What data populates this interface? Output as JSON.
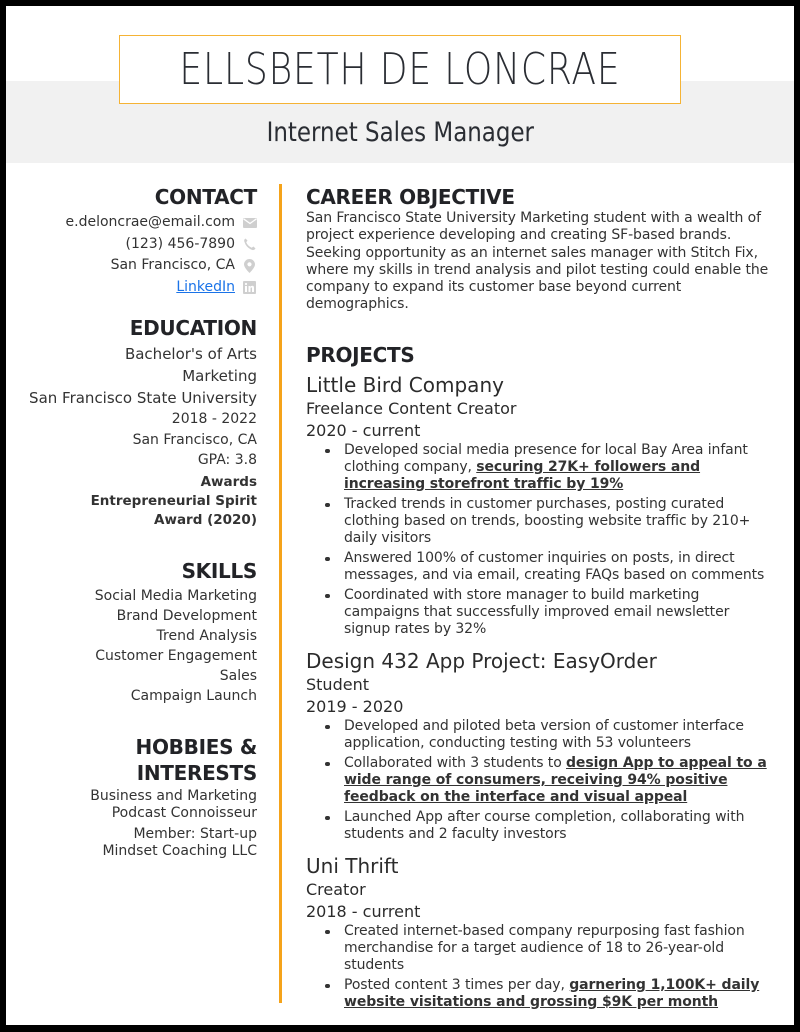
{
  "header": {
    "name": "ELLSBETH DE LONCRAE",
    "title": "Internet Sales Manager",
    "accent_color": "#f5a31a"
  },
  "contact": {
    "heading": "CONTACT",
    "email": "e.deloncrae@email.com",
    "email_icon": "envelope-icon",
    "phone": "(123) 456-7890",
    "phone_icon": "phone-icon",
    "location": "San Francisco, CA",
    "location_icon": "map-pin-icon",
    "linkedin_label": "LinkedIn",
    "linkedin_icon": "linkedin-icon"
  },
  "education": {
    "heading": "EDUCATION",
    "degree": "Bachelor's of Arts",
    "major": "Marketing",
    "school": "San Francisco State University",
    "years": "2018 - 2022",
    "location": "San Francisco, CA",
    "gpa": "GPA: 3.8",
    "awards_label": "Awards",
    "award": "Entrepreneurial Spirit Award (2020)"
  },
  "skills": {
    "heading": "SKILLS",
    "items": [
      "Social Media Marketing",
      "Brand Development",
      "Trend Analysis",
      "Customer Engagement",
      "Sales",
      "Campaign Launch"
    ]
  },
  "hobbies": {
    "heading": "HOBBIES & INTERESTS",
    "items": [
      "Business and Marketing Podcast Connoisseur",
      "Member: Start-up Mindset Coaching LLC"
    ]
  },
  "objective": {
    "heading": "CAREER OBJECTIVE",
    "text": "San Francisco State University Marketing student with a wealth of project experience developing and creating SF-based brands. Seeking opportunity as an internet sales manager with Stitch Fix, where my skills in trend analysis and pilot testing could enable the company to expand its customer base beyond current demographics."
  },
  "projects": {
    "heading": "PROJECTS",
    "items": [
      {
        "name": "Little Bird Company",
        "role": "Freelance Content Creator",
        "dates": "2020 - current",
        "bullets": [
          {
            "pre": "Developed social media presence for local Bay Area infant clothing company, ",
            "hl": "securing 27K+ followers and increasing storefront traffic by 19%",
            "post": ""
          },
          {
            "pre": "Tracked trends in customer purchases, posting curated clothing based on trends, boosting website traffic by 210+ daily visitors",
            "hl": "",
            "post": ""
          },
          {
            "pre": "Answered 100% of customer inquiries on posts, in direct messages, and via email, creating FAQs based on comments",
            "hl": "",
            "post": ""
          },
          {
            "pre": "Coordinated with store manager to build marketing campaigns that successfully improved email newsletter signup rates by 32%",
            "hl": "",
            "post": ""
          }
        ]
      },
      {
        "name": "Design 432 App Project: EasyOrder",
        "role": "Student",
        "dates": "2019 - 2020",
        "bullets": [
          {
            "pre": "Developed and piloted beta version of customer interface application, conducting testing with 53 volunteers",
            "hl": "",
            "post": ""
          },
          {
            "pre": "Collaborated with 3 students to ",
            "hl": "design App to appeal to a wide range of consumers, receiving 94% positive feedback on the interface and visual appeal",
            "post": ""
          },
          {
            "pre": "Launched App after course completion, collaborating with students and 2 faculty investors",
            "hl": "",
            "post": ""
          }
        ]
      },
      {
        "name": "Uni Thrift",
        "role": "Creator",
        "dates": "2018 - current",
        "bullets": [
          {
            "pre": "Created internet-based company repurposing fast fashion merchandise for a target audience of 18 to 26-year-old students",
            "hl": "",
            "post": ""
          },
          {
            "pre": "Posted content 3 times per day, ",
            "hl": "garnering 1,100K+ daily website visitations and grossing $9K per month",
            "post": ""
          }
        ]
      }
    ]
  }
}
